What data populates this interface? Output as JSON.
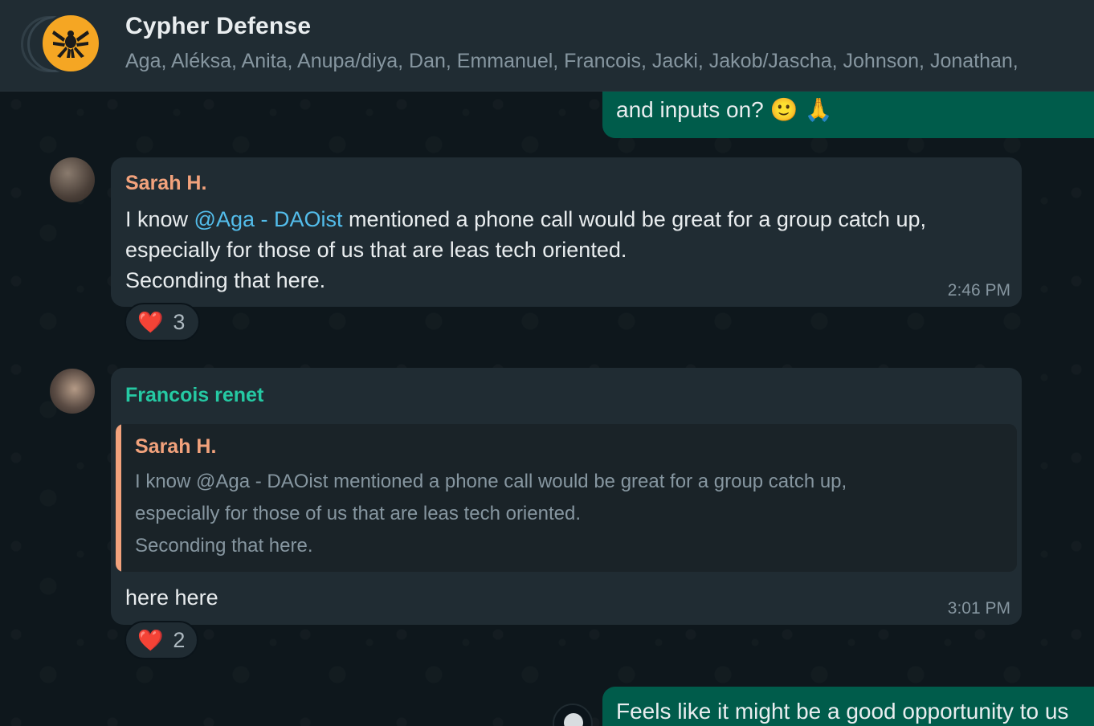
{
  "header": {
    "title": "Cypher Defense",
    "members": "Aga, Aléksa, Anita, Anupa/diya, Dan, Emmanuel, Francois, Jacki, Jakob/Jascha, Johnson, Jonathan,"
  },
  "messages": {
    "out_top": {
      "text": "and inputs on?",
      "emoji1": "🙂",
      "emoji2": "🙏"
    },
    "sarah": {
      "sender": "Sarah H.",
      "line1_pre": "I know ",
      "mention": "@Aga - DAOist",
      "line1_post": " mentioned a phone call would be great for a group catch up,",
      "line2": "especially for those of us that are leas tech oriented.",
      "line3": "Seconding that here.",
      "time": "2:46 PM",
      "reaction_emoji": "❤️",
      "reaction_count": "3"
    },
    "francois": {
      "sender": "Francois renet",
      "quote_sender": "Sarah H.",
      "quote_line1": "I know @Aga - DAOist mentioned a phone call would be great for a group catch up,",
      "quote_line2": "especially for those of us that are leas tech oriented.",
      "quote_line3": "Seconding that here.",
      "text": "here here",
      "time": "3:01 PM",
      "reaction_emoji": "❤️",
      "reaction_count": "2"
    },
    "out_bottom": {
      "text": "Feels like it might be a good opportunity to us"
    }
  },
  "colors": {
    "header_bg": "#202c33",
    "incoming_bubble": "#202c33",
    "outgoing_bubble": "#005c4b",
    "sender_sarah": "#f2a27c",
    "sender_francois": "#25c9a3",
    "mention": "#53bdeb"
  }
}
